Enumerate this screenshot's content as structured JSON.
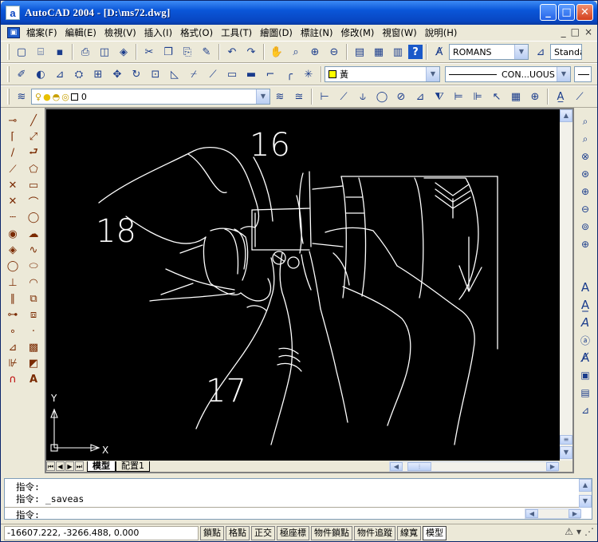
{
  "window": {
    "title": "AutoCAD 2004 - [D:\\ms72.dwg]",
    "app_icon_glyph": "a",
    "minimize_glyph": "_",
    "maximize_glyph": "□",
    "close_glyph": "✕"
  },
  "menu": {
    "items": [
      "檔案(F)",
      "編輯(E)",
      "檢視(V)",
      "插入(I)",
      "格式(O)",
      "工具(T)",
      "繪圖(D)",
      "標註(N)",
      "修改(M)",
      "視窗(W)",
      "說明(H)"
    ],
    "mdi_controls": [
      "_",
      "□",
      "×"
    ]
  },
  "standard_toolbar": {
    "text_style": "ROMANS",
    "dim_style": "Standard"
  },
  "properties_toolbar": {
    "color": "黃",
    "color_swatch": "#ffff00",
    "linetype": "CON...UOUS"
  },
  "layers_toolbar": {
    "layer": "0"
  },
  "drawing": {
    "callouts": [
      "16",
      "18",
      "17"
    ],
    "ucs_x_label": "X",
    "ucs_y_label": "Y",
    "line_color": "#ffffff",
    "background": "#000000"
  },
  "layout_tabs": {
    "tabs": [
      "模型",
      "配置1"
    ],
    "active": "模型"
  },
  "command": {
    "history": [
      "指令:",
      "指令:  _saveas"
    ],
    "prompt": "指令:"
  },
  "status": {
    "coordinates": "-16607.222, -3266.488, 0.000",
    "toggles": [
      "鎖點",
      "格點",
      "正交",
      "極座標",
      "物件鎖點",
      "物件追蹤",
      "線寬",
      "模型"
    ],
    "active_toggles": [
      "模型"
    ]
  },
  "colors": {
    "title_bar": "#0a56d8",
    "chrome": "#ece9d8",
    "close_button": "#d3401e"
  },
  "icons": {
    "standard": [
      "new-icon",
      "open-icon",
      "save-icon",
      "plot-icon",
      "plot-preview-icon",
      "publish-icon",
      "cut-icon",
      "copy-icon",
      "paste-icon",
      "match-properties-icon",
      "undo-icon",
      "redo-icon",
      "pan-icon",
      "zoom-realtime-icon",
      "zoom-window-icon",
      "zoom-previous-icon",
      "properties-icon",
      "design-center-icon",
      "tool-palettes-icon",
      "help-icon"
    ],
    "draw": [
      "line-icon",
      "construction-line-icon",
      "polyline-icon",
      "polygon-icon",
      "rectangle-icon",
      "arc-icon",
      "circle-icon",
      "revision-cloud-icon",
      "spline-icon",
      "ellipse-icon",
      "insert-block-icon",
      "make-block-icon",
      "point-icon",
      "hatch-icon",
      "region-icon",
      "multiline-text-icon"
    ],
    "modify": [
      "erase-icon",
      "copy-object-icon",
      "mirror-icon",
      "offset-icon",
      "array-icon",
      "move-icon",
      "rotate-icon",
      "scale-icon",
      "stretch-icon",
      "trim-icon",
      "extend-icon",
      "break-icon",
      "chamfer-icon",
      "fillet-icon",
      "explode-icon"
    ]
  }
}
